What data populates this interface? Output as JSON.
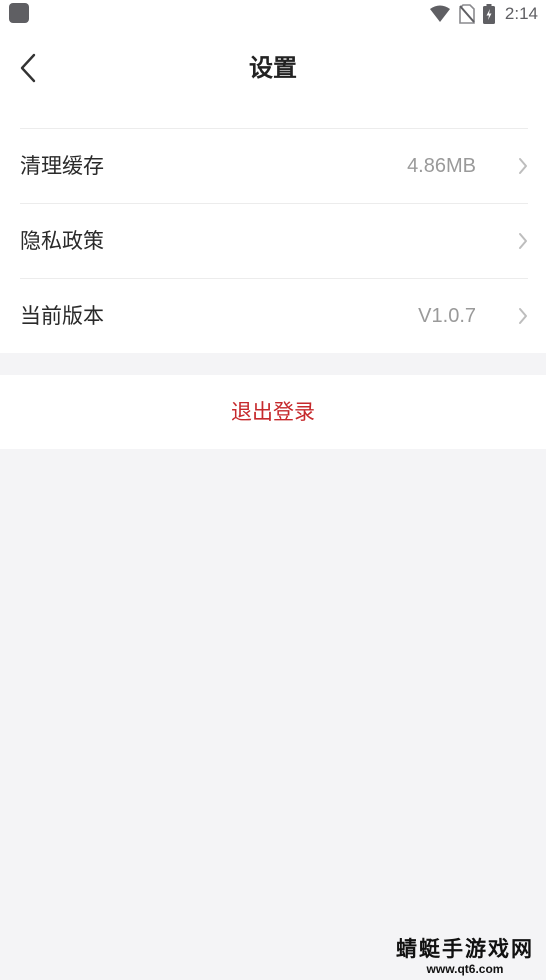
{
  "status_bar": {
    "time": "2:14",
    "icons": [
      "app-notification-icon",
      "wifi-icon",
      "no-sim-icon",
      "battery-charging-icon"
    ]
  },
  "header": {
    "title": "设置",
    "back_icon": "chevron-left-icon"
  },
  "settings": {
    "items": [
      {
        "label": "清理缓存",
        "value": "4.86MB",
        "icon": "chevron-right-icon"
      },
      {
        "label": "隐私政策",
        "value": "",
        "icon": "chevron-right-icon"
      },
      {
        "label": "当前版本",
        "value": "V1.0.7",
        "icon": "chevron-right-icon"
      }
    ]
  },
  "logout": {
    "label": "退出登录"
  },
  "watermark": {
    "title": "蜻蜓手游戏网",
    "url": "www.qt6.com"
  },
  "colors": {
    "page_background": "#f4f4f6",
    "surface": "#ffffff",
    "primary_text": "#222222",
    "secondary_text": "#9a9a9a",
    "danger": "#c6292c",
    "status_icon": "#5f5f63"
  }
}
